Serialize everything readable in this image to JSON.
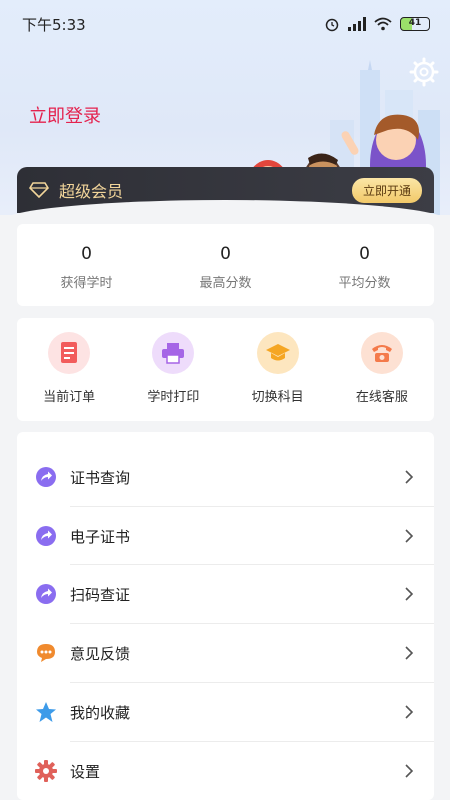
{
  "status_bar": {
    "time": "下午5:33",
    "battery": "41"
  },
  "header": {
    "login": "立即登录"
  },
  "vip": {
    "label": "超级会员",
    "button": "立即开通"
  },
  "stats": [
    {
      "value": "0",
      "label": "获得学时"
    },
    {
      "value": "0",
      "label": "最高分数"
    },
    {
      "value": "0",
      "label": "平均分数"
    }
  ],
  "quick_actions": [
    {
      "label": "当前订单",
      "icon": "document-icon",
      "color": "#f26b6b"
    },
    {
      "label": "学时打印",
      "icon": "printer-icon",
      "color": "#a565e6"
    },
    {
      "label": "切换科目",
      "icon": "graduation-cap-icon",
      "color": "#f5a623"
    },
    {
      "label": "在线客服",
      "icon": "phone-icon",
      "color": "#f47a4a"
    }
  ],
  "menu": [
    {
      "label": "证书查询",
      "icon": "share-arrow-icon"
    },
    {
      "label": "电子证书",
      "icon": "share-arrow-icon"
    },
    {
      "label": "扫码查证",
      "icon": "share-arrow-icon"
    },
    {
      "label": "意见反馈",
      "icon": "chat-bubble-icon"
    },
    {
      "label": "我的收藏",
      "icon": "star-icon"
    },
    {
      "label": "设置",
      "icon": "gear-icon"
    }
  ],
  "colors": {
    "accent": "#e4224e",
    "vip_gold": "#f2d59a",
    "purple": "#8a6df0",
    "orange": "#f08a2e",
    "blue": "#3d9be9",
    "red": "#e0615a"
  }
}
